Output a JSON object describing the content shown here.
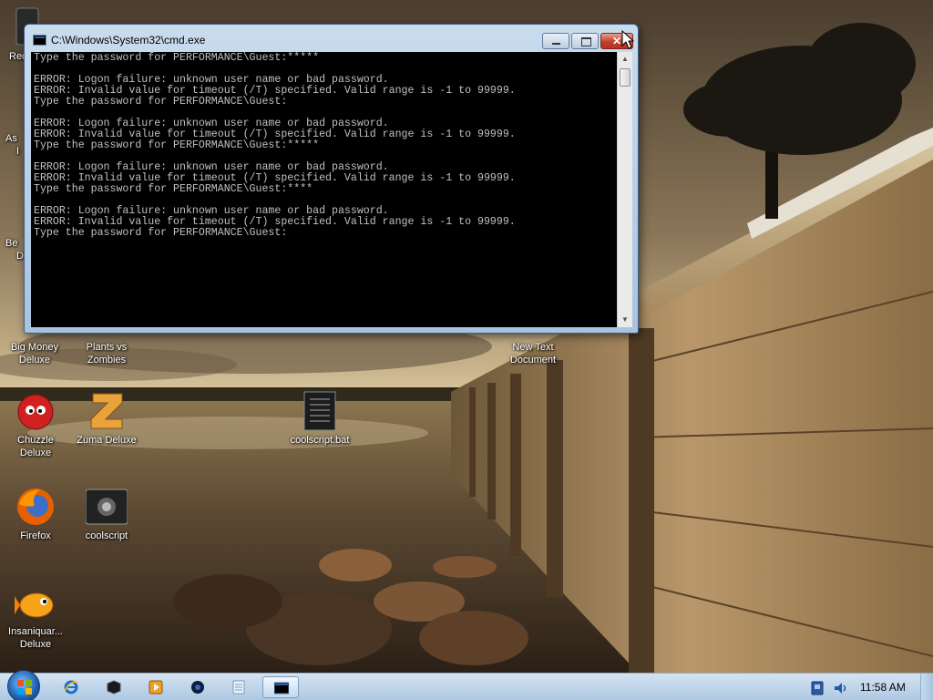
{
  "window": {
    "title": "C:\\Windows\\System32\\cmd.exe",
    "console_lines": [
      "Type the password for PERFORMANCE\\Guest:*****",
      "",
      "ERROR: Logon failure: unknown user name or bad password.",
      "ERROR: Invalid value for timeout (/T) specified. Valid range is -1 to 99999.",
      "Type the password for PERFORMANCE\\Guest:",
      "",
      "ERROR: Logon failure: unknown user name or bad password.",
      "ERROR: Invalid value for timeout (/T) specified. Valid range is -1 to 99999.",
      "Type the password for PERFORMANCE\\Guest:*****",
      "",
      "ERROR: Logon failure: unknown user name or bad password.",
      "ERROR: Invalid value for timeout (/T) specified. Valid range is -1 to 99999.",
      "Type the password for PERFORMANCE\\Guest:****",
      "",
      "ERROR: Logon failure: unknown user name or bad password.",
      "ERROR: Invalid value for timeout (/T) specified. Valid range is -1 to 99999.",
      "Type the password for PERFORMANCE\\Guest:"
    ]
  },
  "desktop": {
    "icons": {
      "recycle": "Rec",
      "a_partial_1": "As",
      "a_partial_2": "I",
      "be_partial_1": "Be",
      "be_partial_2": "D",
      "big_money": "Big Money\nDeluxe",
      "plants": "Plants vs\nZombies",
      "new_text": "New Text\nDocument",
      "chuzzle": "Chuzzle\nDeluxe",
      "zuma": "Zuma Deluxe",
      "coolscript_bat": "coolscript.bat",
      "firefox": "Firefox",
      "coolscript": "coolscript",
      "insaniquarium": "Insaniquar...\nDeluxe"
    }
  },
  "taskbar": {
    "pinned": [
      "internet-explorer-icon",
      "cube-app-icon",
      "media-player-icon",
      "disc-app-icon",
      "notepad-icon",
      "cmd-icon"
    ],
    "clock": "11:58 AM"
  },
  "colors": {
    "console_bg": "#000000",
    "console_text": "#c0c0c0",
    "taskbar": "#bcd3ea",
    "close_button": "#c0402a"
  }
}
